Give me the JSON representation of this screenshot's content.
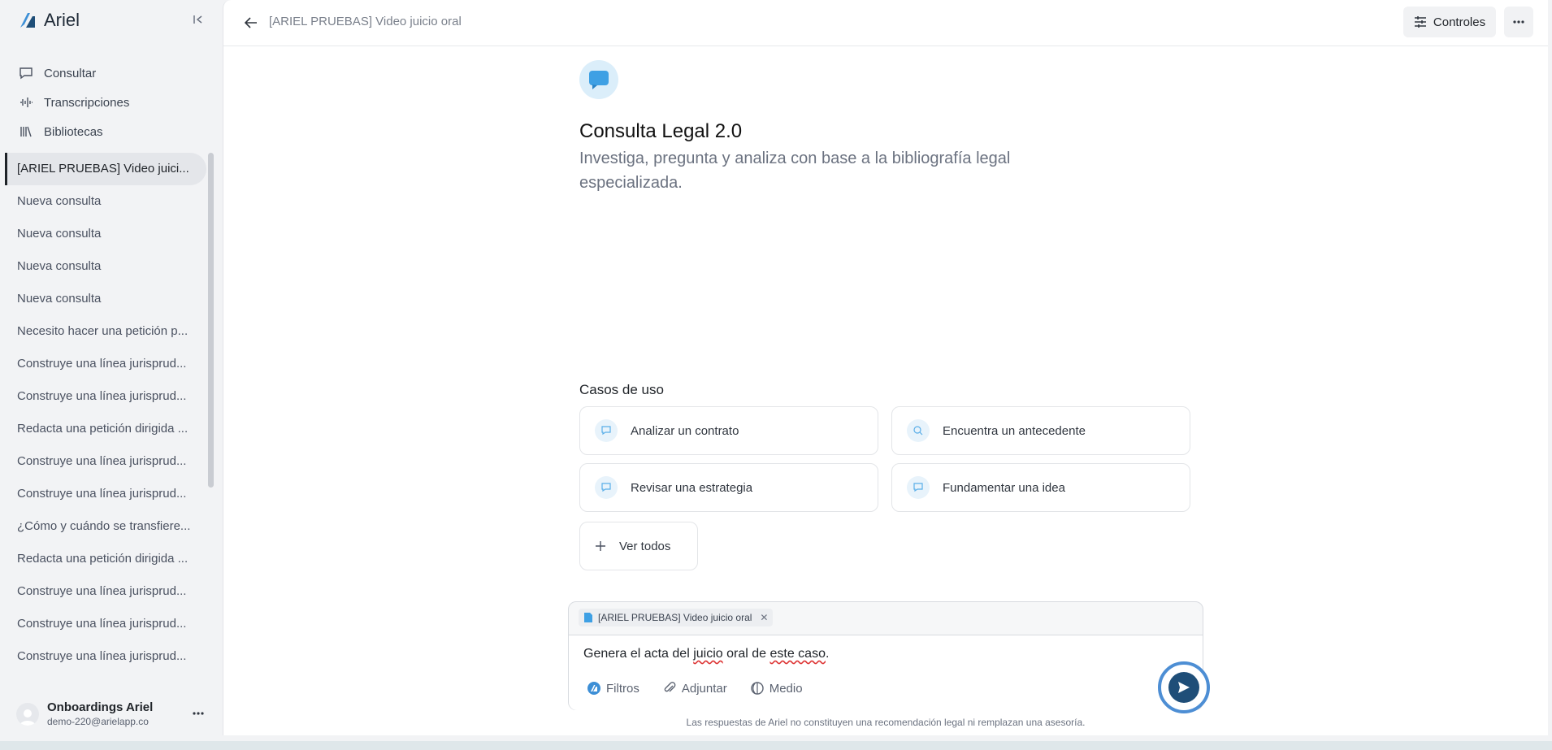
{
  "brand": {
    "name": "Ariel"
  },
  "nav": {
    "items": [
      {
        "label": "Consultar",
        "icon": "chat-bubble-icon"
      },
      {
        "label": "Transcripciones",
        "icon": "audio-wave-icon"
      },
      {
        "label": "Bibliotecas",
        "icon": "library-icon"
      }
    ]
  },
  "history": {
    "items": [
      "[ARIEL PRUEBAS] Video juici...",
      "Nueva consulta",
      "Nueva consulta",
      "Nueva consulta",
      "Nueva consulta",
      "Necesito hacer una petición p...",
      "Construye una línea jurisprud...",
      "Construye una línea jurisprud...",
      "Redacta una petición dirigida ...",
      "Construye una línea jurisprud...",
      "Construye una línea jurisprud...",
      "¿Cómo y cuándo se transfiere...",
      "Redacta una petición dirigida ...",
      "Construye una línea jurisprud...",
      "Construye una línea jurisprud...",
      "Construye una línea jurisprud..."
    ]
  },
  "user": {
    "name": "Onboardings Ariel",
    "email": "demo-220@arielapp.co"
  },
  "topbar": {
    "breadcrumb": "[ARIEL PRUEBAS] Video juicio oral",
    "controls_label": "Controles"
  },
  "hero": {
    "title": "Consulta Legal 2.0",
    "subtitle": "Investiga, pregunta y analiza con base a la bibliografía legal especializada."
  },
  "use_cases": {
    "title": "Casos de uso",
    "items": [
      {
        "label": "Analizar un contrato",
        "icon": "chat-bubble-icon"
      },
      {
        "label": "Encuentra un antecedente",
        "icon": "search-icon"
      },
      {
        "label": "Revisar una estrategia",
        "icon": "chat-bubble-icon"
      },
      {
        "label": "Fundamentar una idea",
        "icon": "chat-bubble-icon"
      }
    ],
    "see_all": "Ver todos"
  },
  "composer": {
    "attachment": "[ARIEL PRUEBAS] Video juicio oral",
    "text_parts": [
      "Genera el acta del ",
      "juicio",
      " oral de ",
      "este caso",
      "."
    ],
    "tools": {
      "filters": "Filtros",
      "attach": "Adjuntar",
      "medium": "Medio"
    }
  },
  "disclaimer": "Las respuestas de Ariel no constituyen una recomendación legal ni remplazan una asesoría.",
  "colors": {
    "accent": "#1f4e78",
    "focus_ring": "#4d8ed4",
    "icon_bg": "#dbeefa"
  }
}
